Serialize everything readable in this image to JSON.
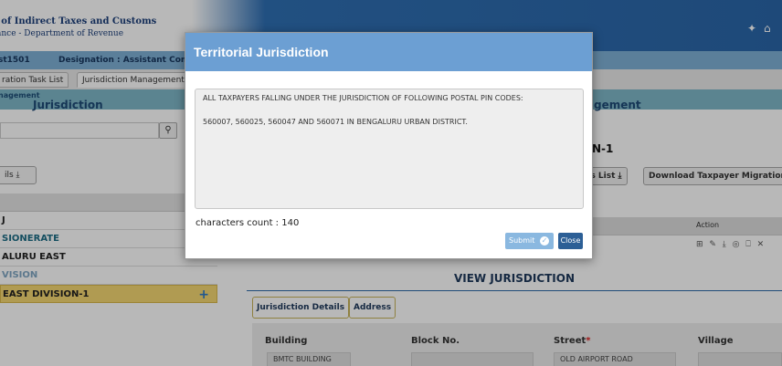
{
  "header": {
    "org_name": "l of Indirect Taxes and Customs",
    "org_sub": "ance - Department of Revenue",
    "icons": [
      "pin-icon",
      "home-icon"
    ]
  },
  "userbar": {
    "user": "st1501",
    "designation": "Designation : Assistant Comm"
  },
  "tabs": [
    {
      "label": "ration Task List"
    },
    {
      "label": "Jurisdiction Management"
    }
  ],
  "breadcrumb": "nagement",
  "left_title": "Jurisdiction",
  "right_title": "gement",
  "left": {
    "search_icon": "search-icon",
    "details_label": "ils ⤓",
    "tree": [
      {
        "label": "J"
      },
      {
        "label": "SIONERATE"
      },
      {
        "label": "ALURU EAST"
      },
      {
        "label": "VISION"
      },
      {
        "label": "EAST DIVISION-1",
        "action": "+"
      }
    ]
  },
  "right": {
    "subtitle": "N-1",
    "btn_taxpayers": "rs List ⤓",
    "btn_download": "Download Taxpayer Migration Ten",
    "table_action_header": "Action",
    "action_icons": "⊞ ✎ ⤓ ◎ ⎕ ✕"
  },
  "view": {
    "title": "VIEW JURISDICTION",
    "tabs": [
      {
        "label": "Jurisdiction Details"
      },
      {
        "label": "Address"
      }
    ],
    "fields": [
      {
        "label": "Building",
        "value": "BMTC BUILDING",
        "required": ""
      },
      {
        "label": "Block No.",
        "value": "",
        "required": ""
      },
      {
        "label": "Street",
        "value": "OLD AIRPORT ROAD",
        "required": "*"
      },
      {
        "label": "Village",
        "value": "",
        "required": ""
      }
    ]
  },
  "modal": {
    "title": "Territorial Jurisdiction",
    "text_line1": "ALL TAXPAYERS FALLING UNDER THE JURISDICTION OF  FOLLOWING POSTAL PIN CODES:",
    "text_line2": "560007, 560025, 560047 AND 560071 IN BENGALURU URBAN DISTRICT.",
    "char_count": "characters count : 140",
    "submit_label": "Submit",
    "close_label": "Close"
  }
}
